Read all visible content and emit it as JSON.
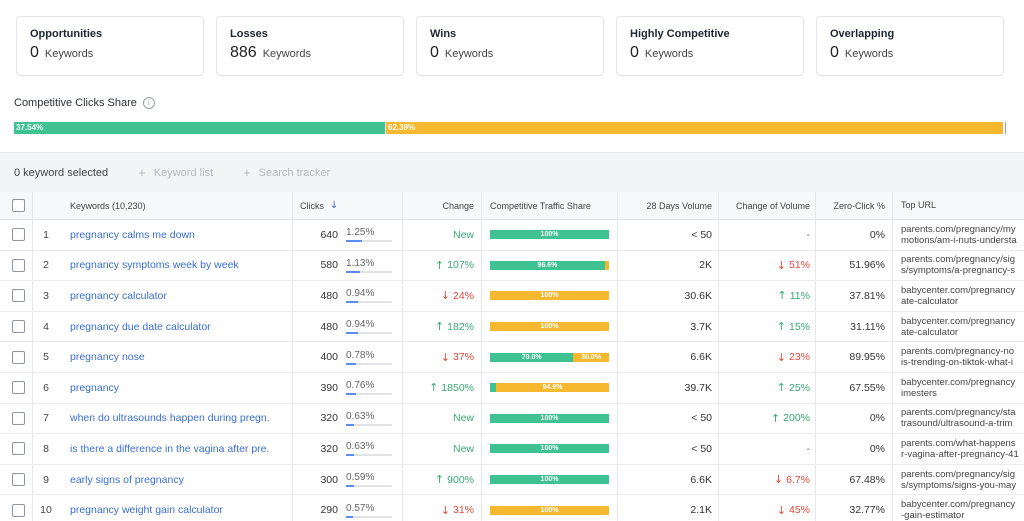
{
  "cards": [
    {
      "title": "Opportunities",
      "value": "0",
      "unit": "Keywords"
    },
    {
      "title": "Losses",
      "value": "886",
      "unit": "Keywords"
    },
    {
      "title": "Wins",
      "value": "0",
      "unit": "Keywords"
    },
    {
      "title": "Highly Competitive",
      "value": "0",
      "unit": "Keywords"
    },
    {
      "title": "Overlapping",
      "value": "0",
      "unit": "Keywords"
    }
  ],
  "share": {
    "label": "Competitive Clicks Share",
    "info_icon": "info-icon",
    "segments": [
      {
        "label": "37.54%",
        "value": 37.54,
        "color": "#3fc292"
      },
      {
        "label": "62.39%",
        "value": 62.39,
        "color": "#f5b82e"
      }
    ]
  },
  "toolbar": {
    "selected": "0 keyword selected",
    "keyword_list": "Keyword list",
    "search_tracker": "Search tracker"
  },
  "table": {
    "headers": {
      "keywords": "Keywords (10,230)",
      "clicks": "Clicks",
      "change": "Change",
      "traffic_share": "Competitive Traffic Share",
      "volume": "28 Days Volume",
      "change_volume": "Change of Volume",
      "zero_click": "Zero-Click %",
      "top_url": "Top URL"
    },
    "colors": {
      "green": "#3fc292",
      "orange": "#f5b82e"
    },
    "rows": [
      {
        "num": "1",
        "keyword": "pregnancy calms me down",
        "clicks": "640",
        "pct": "1.25%",
        "pct_value": 1.25,
        "change": "New",
        "change_dir": "new",
        "traffic": [
          {
            "value": 100,
            "label": "100%",
            "color": "green"
          }
        ],
        "volume": "< 50",
        "change_volume": "-",
        "cv_dir": "none",
        "zero": "0%",
        "url1": "parents.com/pregnancy/my",
        "url2": "motions/am-i-nuts-understa"
      },
      {
        "num": "2",
        "keyword": "pregnancy symptoms week by week",
        "clicks": "580",
        "pct": "1.13%",
        "pct_value": 1.13,
        "change": "107%",
        "change_dir": "up",
        "traffic": [
          {
            "value": 96.6,
            "label": "96.6%",
            "color": "green"
          },
          {
            "value": 3.4,
            "label": "",
            "color": "orange"
          }
        ],
        "volume": "2K",
        "change_volume": "51%",
        "cv_dir": "down",
        "zero": "51.96%",
        "url1": "parents.com/pregnancy/sig",
        "url2": "s/symptoms/a-pregnancy-s"
      },
      {
        "num": "3",
        "keyword": "pregnancy calculator",
        "clicks": "480",
        "pct": "0.94%",
        "pct_value": 0.94,
        "change": "24%",
        "change_dir": "down",
        "traffic": [
          {
            "value": 100,
            "label": "100%",
            "color": "orange"
          }
        ],
        "volume": "30.6K",
        "change_volume": "11%",
        "cv_dir": "up",
        "zero": "37.81%",
        "url1": "babycenter.com/pregnancy",
        "url2": "ate-calculator"
      },
      {
        "num": "4",
        "keyword": "pregnancy due date calculator",
        "clicks": "480",
        "pct": "0.94%",
        "pct_value": 0.94,
        "change": "182%",
        "change_dir": "up",
        "traffic": [
          {
            "value": 100,
            "label": "100%",
            "color": "orange"
          }
        ],
        "volume": "3.7K",
        "change_volume": "15%",
        "cv_dir": "up",
        "zero": "31.11%",
        "url1": "babycenter.com/pregnancy",
        "url2": "ate-calculator"
      },
      {
        "num": "5",
        "keyword": "pregnancy nose",
        "clicks": "400",
        "pct": "0.78%",
        "pct_value": 0.78,
        "change": "37%",
        "change_dir": "down",
        "traffic": [
          {
            "value": 70,
            "label": "70.0%",
            "color": "green"
          },
          {
            "value": 30,
            "label": "30.0%",
            "color": "orange"
          }
        ],
        "volume": "6.6K",
        "change_volume": "23%",
        "cv_dir": "down",
        "zero": "89.95%",
        "url1": "parents.com/pregnancy-no",
        "url2": "is-trending-on-tiktok-what-i"
      },
      {
        "num": "6",
        "keyword": "pregnancy",
        "clicks": "390",
        "pct": "0.76%",
        "pct_value": 0.76,
        "change": "1850%",
        "change_dir": "up",
        "traffic": [
          {
            "value": 5.1,
            "label": "",
            "color": "green"
          },
          {
            "value": 94.9,
            "label": "94.9%",
            "color": "orange"
          }
        ],
        "volume": "39.7K",
        "change_volume": "25%",
        "cv_dir": "up",
        "zero": "67.55%",
        "url1": "babycenter.com/pregnancy",
        "url2": "imesters"
      },
      {
        "num": "7",
        "keyword": "when do ultrasounds happen during pregn...",
        "clicks": "320",
        "pct": "0.63%",
        "pct_value": 0.63,
        "change": "New",
        "change_dir": "new",
        "traffic": [
          {
            "value": 100,
            "label": "100%",
            "color": "green"
          }
        ],
        "volume": "< 50",
        "change_volume": "200%",
        "cv_dir": "up",
        "zero": "0%",
        "url1": "parents.com/pregnancy/sta",
        "url2": "trasound/ultrasound-a-trim"
      },
      {
        "num": "8",
        "keyword": "is there a difference in the vagina after pre...",
        "clicks": "320",
        "pct": "0.63%",
        "pct_value": 0.63,
        "change": "New",
        "change_dir": "new",
        "traffic": [
          {
            "value": 100,
            "label": "100%",
            "color": "green"
          }
        ],
        "volume": "< 50",
        "change_volume": "-",
        "cv_dir": "none",
        "zero": "0%",
        "url1": "parents.com/what-happens",
        "url2": "r-vagina-after-pregnancy-41"
      },
      {
        "num": "9",
        "keyword": "early signs of pregnancy",
        "clicks": "300",
        "pct": "0.59%",
        "pct_value": 0.59,
        "change": "900%",
        "change_dir": "up",
        "traffic": [
          {
            "value": 100,
            "label": "100%",
            "color": "green"
          }
        ],
        "volume": "6.6K",
        "change_volume": "6.7%",
        "cv_dir": "down",
        "zero": "67.48%",
        "url1": "parents.com/pregnancy/sig",
        "url2": "s/symptoms/signs-you-may"
      },
      {
        "num": "10",
        "keyword": "pregnancy weight gain calculator",
        "clicks": "290",
        "pct": "0.57%",
        "pct_value": 0.57,
        "change": "31%",
        "change_dir": "down",
        "traffic": [
          {
            "value": 100,
            "label": "100%",
            "color": "orange"
          }
        ],
        "volume": "2.1K",
        "change_volume": "45%",
        "cv_dir": "down",
        "zero": "32.77%",
        "url1": "babycenter.com/pregnancy",
        "url2": "-gain-estimator"
      }
    ]
  }
}
